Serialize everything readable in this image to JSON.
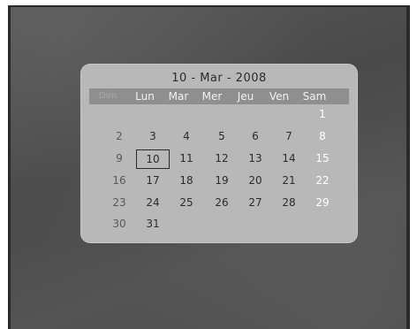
{
  "calendar": {
    "title": "10 - Mar - 2008",
    "day_names": [
      "Dim",
      "Lun",
      "Mar",
      "Mer",
      "Jeu",
      "Ven",
      "Sam"
    ],
    "weeks": [
      [
        "",
        "",
        "",
        "",
        "",
        "",
        "1"
      ],
      [
        "2",
        "3",
        "4",
        "5",
        "6",
        "7",
        "8"
      ],
      [
        "9",
        "10",
        "11",
        "12",
        "13",
        "14",
        "15"
      ],
      [
        "16",
        "17",
        "18",
        "19",
        "20",
        "21",
        "22"
      ],
      [
        "23",
        "24",
        "25",
        "26",
        "27",
        "28",
        "29"
      ],
      [
        "30",
        "31",
        "",
        "",
        "",
        "",
        ""
      ]
    ],
    "selected_day": "10"
  }
}
